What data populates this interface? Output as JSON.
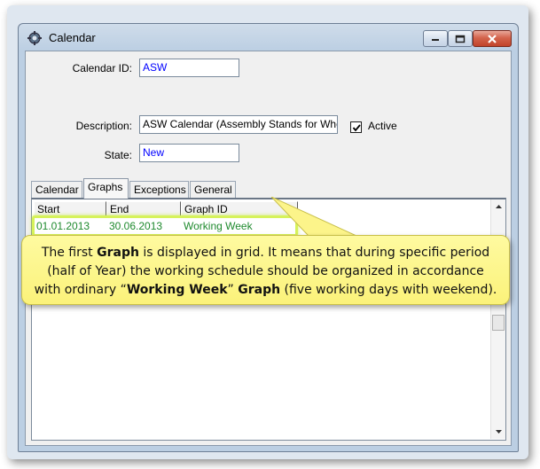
{
  "window": {
    "title": "Calendar"
  },
  "form": {
    "calendar_id_label": "Calendar ID:",
    "calendar_id_value": "ASW",
    "description_label": "Description:",
    "description_value": "ASW Calendar (Assembly Stands for Wheels)",
    "active_label": "Active",
    "active_checked": true,
    "state_label": "State:",
    "state_value": "New"
  },
  "tabs": [
    "Calendar",
    "Graphs",
    "Exceptions",
    "General"
  ],
  "active_tab": "Graphs",
  "grid": {
    "columns": [
      "Start",
      "End",
      "Graph ID"
    ],
    "rows": [
      {
        "start": "01.01.2013",
        "end": "30.06.2013",
        "graph_id": "Working Week"
      }
    ]
  },
  "callout": {
    "line1_a": "The first ",
    "line1_b": "Graph",
    "line1_c": " is displayed in grid. It means that during specific period",
    "line2": "(half of Year) the working schedule should be organized in accordance",
    "line3_a": "with ordinary “",
    "line3_b": "Working Week",
    "line3_c": "” ",
    "line3_d": "Graph",
    "line3_e": " (five working days with weekend)."
  },
  "colors": {
    "value_text": "#0000ff",
    "grid_row_text": "#1f8a2e",
    "highlight": "#d6f25a",
    "callout_bg": "#fbf27a"
  }
}
